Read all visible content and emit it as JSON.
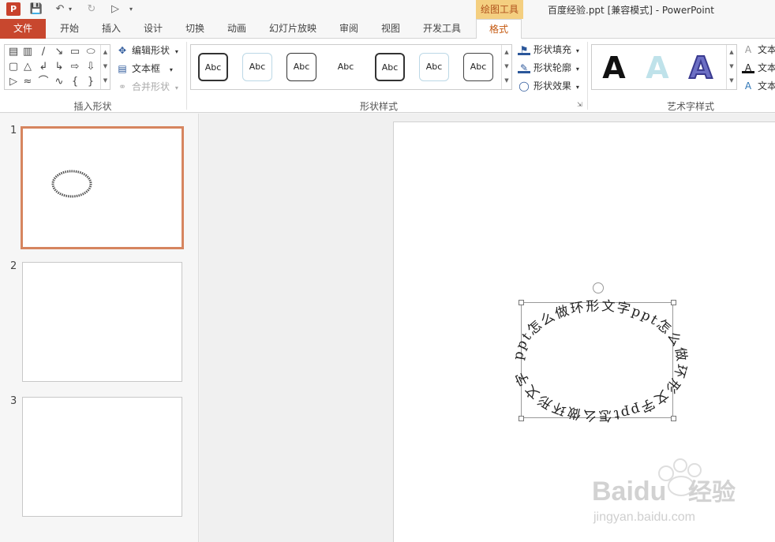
{
  "titlebar": {
    "app_icon": "P",
    "context_group": "绘图工具",
    "window_title": "百度经验.ppt [兼容模式] - PowerPoint",
    "quick_access": [
      "save-icon",
      "undo-icon",
      "redo-icon",
      "start-slideshow-icon"
    ]
  },
  "tabs": [
    {
      "label": "文件"
    },
    {
      "label": "开始"
    },
    {
      "label": "插入"
    },
    {
      "label": "设计"
    },
    {
      "label": "切换"
    },
    {
      "label": "动画"
    },
    {
      "label": "幻灯片放映"
    },
    {
      "label": "审阅"
    },
    {
      "label": "视图"
    },
    {
      "label": "开发工具"
    },
    {
      "label": "格式"
    }
  ],
  "ribbon": {
    "insert_shapes": {
      "label": "插入形状",
      "edit_shape": "编辑形状",
      "text_box": "文本框",
      "merge_shapes": "合并形状"
    },
    "shape_styles": {
      "label": "形状样式",
      "preview_text": "Abc",
      "fill": "形状填充",
      "outline": "形状轮廓",
      "effects": "形状效果"
    },
    "wordart_styles": {
      "label": "艺术字样式",
      "preview_letter": "A",
      "text_items": [
        "文本",
        "文本",
        "文本"
      ]
    }
  },
  "slides": [
    {
      "number": "1",
      "selected": true
    },
    {
      "number": "2",
      "selected": false
    },
    {
      "number": "3",
      "selected": false
    }
  ],
  "canvas": {
    "circular_text": "ppt怎么做环形文字ppt怎么做环形文字ppt怎么做环形文字",
    "watermark_brand": "Baidu",
    "watermark_cn": "经验",
    "watermark_url": "jingyan.baidu.com"
  },
  "colors": {
    "file_tab": "#c8472e",
    "context_tab": "#f4cf80",
    "active_tab_text": "#c55a11",
    "selected_thumb_border": "#d6855f"
  }
}
